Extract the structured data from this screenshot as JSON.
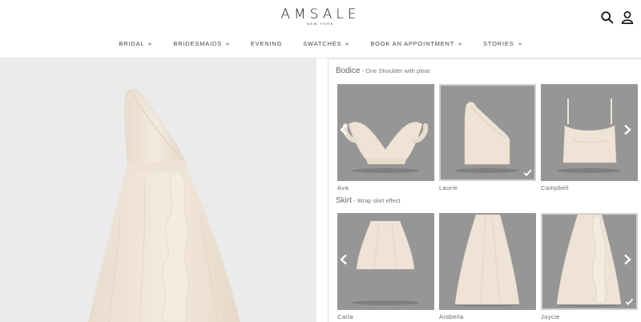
{
  "brand": {
    "name": "AMSALE",
    "sub": "NEW YORK"
  },
  "header_icons": {
    "search": "search-icon",
    "account": "user-icon"
  },
  "nav": [
    {
      "label": "BRIDAL",
      "dropdown": true
    },
    {
      "label": "BRIDESMAIDS",
      "dropdown": true
    },
    {
      "label": "EVENING",
      "dropdown": false
    },
    {
      "label": "SWATCHES",
      "dropdown": true
    },
    {
      "label": "BOOK AN APPOINTMENT",
      "dropdown": true
    },
    {
      "label": "STORIES",
      "dropdown": true
    }
  ],
  "builder": {
    "bodice": {
      "title": "Bodice",
      "subtitle": " - One Shoulder with pleat",
      "options": [
        {
          "label": "Ava",
          "selected": false
        },
        {
          "label": "Laurie",
          "selected": true
        },
        {
          "label": "Campbell",
          "selected": false
        }
      ]
    },
    "skirt": {
      "title": "Skirt",
      "subtitle": " - Wrap skirt effect",
      "options": [
        {
          "label": "Carla",
          "selected": false
        },
        {
          "label": "Arabella",
          "selected": false
        },
        {
          "label": "Jaycie",
          "selected": true
        }
      ]
    }
  },
  "colors": {
    "fabric": "#efe3d6",
    "card_bg": "#969696",
    "preview_bg": "#ebebeb"
  }
}
